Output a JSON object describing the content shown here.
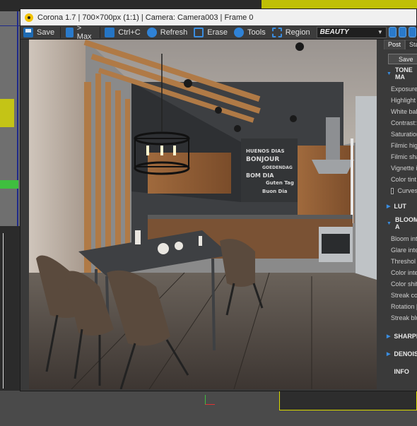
{
  "window": {
    "title": "Corona 1.7 | 700×700px (1:1) | Camera: Camera003 | Frame 0"
  },
  "toolbar": {
    "save_label": "Save",
    "max_label": "> Max",
    "ctrlc_label": "Ctrl+C",
    "refresh_label": "Refresh",
    "erase_label": "Erase",
    "tools_label": "Tools",
    "region_label": "Region",
    "pass_selected": "BEAUTY"
  },
  "panel": {
    "tabs": [
      "Post",
      "Sta"
    ],
    "save_label": "Save",
    "tone_mapping": {
      "header": "TONE MA",
      "rows": [
        "Exposure",
        "Highlight",
        "White bal",
        "Contrast:",
        "Saturation",
        "Filmic hig",
        "Filmic sha",
        "Vignette i",
        "Color tint"
      ],
      "curves_label": "Curves"
    },
    "lut_header": "LUT",
    "bloom": {
      "header": "BLOOM A",
      "rows": [
        "Bloom int",
        "Glare inte",
        "Threshol",
        "Color inte",
        "Color shif",
        "Streak co",
        "Rotation [",
        "Streak blu"
      ]
    },
    "sharpen_header": "SHARPEN",
    "denoise_header": "DENOISE",
    "info_header": "INFO"
  },
  "render": {
    "chalkboard_text": [
      "HUENOS DIAS",
      "BONJOUR",
      "GOEDENDAG",
      "BOM DIA",
      "Guten Tag",
      "Buon Dia"
    ]
  },
  "colors": {
    "accent": "#3a8de0",
    "title_bg": "#f0f0f0",
    "logo": "#f2c200"
  }
}
